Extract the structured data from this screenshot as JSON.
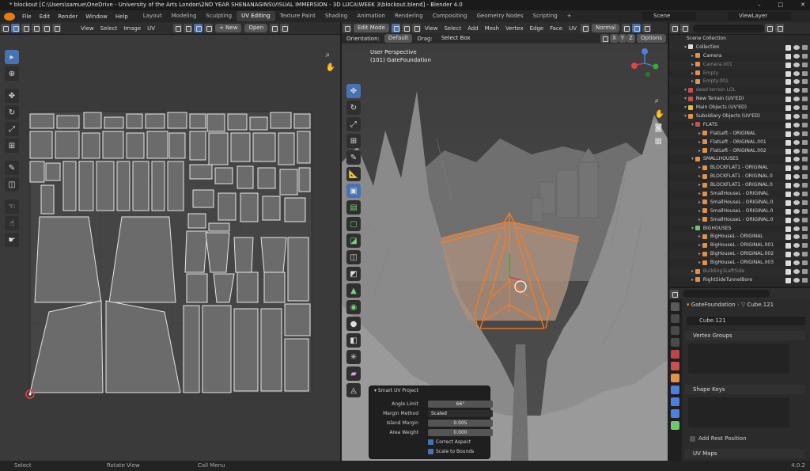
{
  "window": {
    "title": "* blockout [C:\\Users\\samue\\OneDrive - University of the Arts London\\2ND YEAR SHENANAGINS\\VISUAL IMMERSION - 3D LUCA\\WEEK 3\\blockout.blend] - Blender 4.0",
    "minimize": "–",
    "maximize": "□",
    "close": "✕"
  },
  "menu": [
    "File",
    "Edit",
    "Render",
    "Window",
    "Help"
  ],
  "workspaces": [
    "Layout",
    "Modeling",
    "Sculpting",
    "UV Editing",
    "Texture Paint",
    "Shading",
    "Animation",
    "Rendering",
    "Compositing",
    "Geometry Nodes",
    "Scripting",
    "+"
  ],
  "active_workspace": "UV Editing",
  "scene": {
    "scene_label": "Scene",
    "viewlayer_label": "ViewLayer"
  },
  "uv_header": {
    "view": "View",
    "select": "Select",
    "image": "Image",
    "uv": "UV",
    "new": "+ New",
    "open": "Open"
  },
  "viewport_header": {
    "mode": "Edit Mode",
    "view": "View",
    "select": "Select",
    "add": "Add",
    "mesh": "Mesh",
    "vertex": "Vertex",
    "edge": "Edge",
    "face": "Face",
    "uv": "UV",
    "normal": "Normal",
    "x": "X",
    "y": "Y",
    "z": "Z",
    "options": "Options"
  },
  "viewport_subheader": {
    "orientation_label": "Orientation:",
    "orientation": "Default",
    "drag_label": "Drag:",
    "drag": "Select Box"
  },
  "viewport_info": {
    "perspective": "User Perspective",
    "object": "(101) GateFoundation"
  },
  "outliner": {
    "root": "Scene Collection",
    "rows": [
      {
        "depth": 1,
        "name": "Collection",
        "kind": "collection",
        "color": "#dcdcdc"
      },
      {
        "depth": 2,
        "name": "Camera",
        "kind": "camera",
        "color": "#e0914b"
      },
      {
        "depth": 2,
        "name": "Camera.001",
        "kind": "camera",
        "color": "#e0914b",
        "dim": true
      },
      {
        "depth": 2,
        "name": "Empty",
        "kind": "empty",
        "color": "#e0914b",
        "dim": true
      },
      {
        "depth": 2,
        "name": "Empty.001",
        "kind": "empty",
        "color": "#e0914b",
        "dim": true
      },
      {
        "depth": 1,
        "name": "dead terrain LOL",
        "kind": "collection",
        "color": "#c85050",
        "dim": true
      },
      {
        "depth": 1,
        "name": "New Terrain (UV'ED)",
        "kind": "collection",
        "color": "#c85050"
      },
      {
        "depth": 1,
        "name": "Main Objects (UV'ED)",
        "kind": "collection",
        "color": "#d8c040"
      },
      {
        "depth": 1,
        "name": "Subsidiary Objects (UV'ED)",
        "kind": "collection",
        "color": "#e0914b"
      },
      {
        "depth": 2,
        "name": "FLATS",
        "kind": "collection",
        "color": "#c85050"
      },
      {
        "depth": 3,
        "name": "FlatLeft - ORIGINAL",
        "kind": "mesh",
        "color": "#e0914b"
      },
      {
        "depth": 3,
        "name": "FlatLeft - ORIGINAL.001",
        "kind": "mesh",
        "color": "#e0914b"
      },
      {
        "depth": 3,
        "name": "FlatLeft - ORIGINAL.002",
        "kind": "mesh",
        "color": "#e0914b"
      },
      {
        "depth": 2,
        "name": "SMALLHOUSES",
        "kind": "collection",
        "color": "#e0914b"
      },
      {
        "depth": 3,
        "name": "BLOCKFLAT1 - ORIGINAL",
        "kind": "mesh",
        "color": "#e0914b"
      },
      {
        "depth": 3,
        "name": "BLOCKFLAT1 - ORIGINAL.0",
        "kind": "mesh",
        "color": "#e0914b"
      },
      {
        "depth": 3,
        "name": "BLOCKFLAT1 - ORIGINAL.0",
        "kind": "mesh",
        "color": "#e0914b"
      },
      {
        "depth": 3,
        "name": "SmallHouseL - ORIGINAL",
        "kind": "mesh",
        "color": "#e0914b"
      },
      {
        "depth": 3,
        "name": "SmallHouseL - ORIGINAL.0",
        "kind": "mesh",
        "color": "#e0914b"
      },
      {
        "depth": 3,
        "name": "SmallHouseL - ORIGINAL.0",
        "kind": "mesh",
        "color": "#e0914b"
      },
      {
        "depth": 3,
        "name": "SmallHouseL - ORIGINAL.0",
        "kind": "mesh",
        "color": "#e0914b"
      },
      {
        "depth": 2,
        "name": "BIGHOUSES",
        "kind": "collection",
        "color": "#6ec86e"
      },
      {
        "depth": 3,
        "name": "BigHouseL - ORIGINAL",
        "kind": "mesh",
        "color": "#e0914b"
      },
      {
        "depth": 3,
        "name": "BigHouseL - ORIGINAL.001",
        "kind": "mesh",
        "color": "#e0914b"
      },
      {
        "depth": 3,
        "name": "BigHouseL - ORIGINAL.002",
        "kind": "mesh",
        "color": "#e0914b"
      },
      {
        "depth": 3,
        "name": "BigHouseL - ORIGINAL.003",
        "kind": "mesh",
        "color": "#e0914b"
      },
      {
        "depth": 2,
        "name": "Building1LeftSide",
        "kind": "mesh",
        "color": "#e0914b",
        "dim": true
      },
      {
        "depth": 2,
        "name": "RightSideTunnelBore",
        "kind": "mesh",
        "color": "#e0914b"
      }
    ]
  },
  "properties": {
    "breadcrumb_object": "GateFoundation",
    "breadcrumb_data": "Cube.121",
    "datablock": "Cube.121",
    "vertex_groups": "Vertex Groups",
    "shape_keys": "Shape Keys",
    "add_rest_position": "Add Rest Position",
    "uv_maps": "UV Maps"
  },
  "smart_uv": {
    "title": "Smart UV Project",
    "angle_limit_label": "Angle Limit",
    "angle_limit": "66°",
    "margin_method_label": "Margin Method",
    "margin_method": "Scaled",
    "island_margin_label": "Island Margin",
    "island_margin": "0.005",
    "area_weight_label": "Area Weight",
    "area_weight": "0.000",
    "correct_aspect": "Correct Aspect",
    "scale_to_bounds": "Scale to Bounds"
  },
  "status": {
    "select": "Select",
    "rotate": "Rotate View",
    "call_menu": "Call Menu",
    "version": "4.0.2"
  },
  "colors": {
    "accent": "#4772b3",
    "selection": "#ff7a1a",
    "uv_line": "#e6e6e6"
  }
}
